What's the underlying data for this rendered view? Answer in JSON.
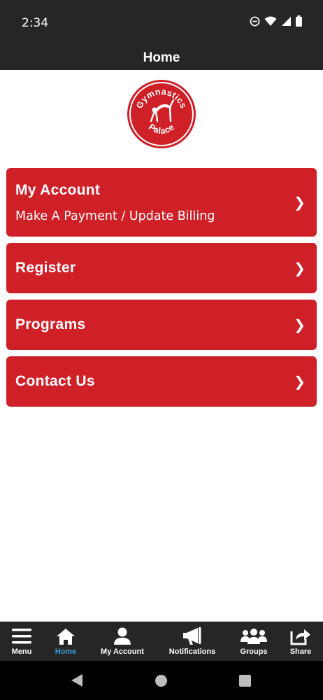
{
  "status_bar": {
    "time": "2:34",
    "icons": [
      "do-not-disturb-icon",
      "wifi-icon",
      "signal-icon",
      "battery-icon"
    ]
  },
  "header": {
    "title": "Home"
  },
  "logo": {
    "line1": "Gymnastics",
    "line2": "Palace",
    "color": "#cf1f27"
  },
  "menu": [
    {
      "title": "My Account",
      "subtitle": "Make A Payment / Update Billing",
      "chevron": "❯"
    },
    {
      "title": "Register",
      "chevron": "❯"
    },
    {
      "title": "Programs",
      "chevron": "❯"
    },
    {
      "title": "Contact Us",
      "chevron": "❯"
    }
  ],
  "bottom_nav": {
    "active": "Home",
    "items": [
      {
        "label": "Menu",
        "icon": "hamburger-icon"
      },
      {
        "label": "Home",
        "icon": "home-icon"
      },
      {
        "label": "My Account",
        "icon": "user-icon"
      },
      {
        "label": "Notifications",
        "icon": "megaphone-icon"
      },
      {
        "label": "Groups",
        "icon": "group-icon"
      },
      {
        "label": "Share",
        "icon": "share-icon"
      }
    ]
  },
  "colors": {
    "accent": "#cf1f27",
    "bar": "#262626",
    "active_nav": "#3b9de0"
  }
}
